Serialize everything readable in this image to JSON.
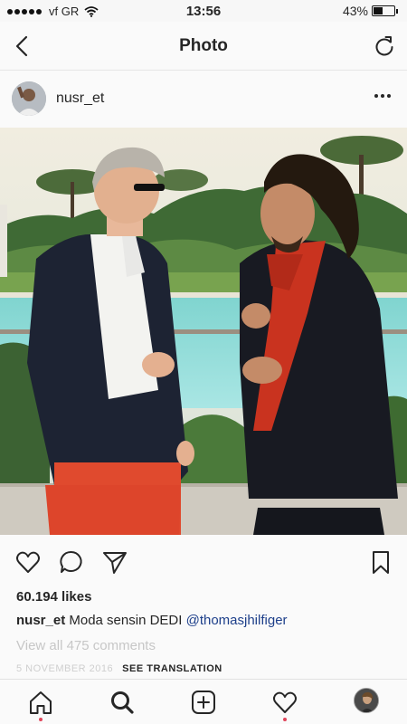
{
  "status_bar": {
    "carrier": "vf GR",
    "time": "13:56",
    "battery_percent_label": "43%",
    "battery_level": 0.43
  },
  "nav": {
    "title": "Photo",
    "back_icon": "chevron-left-icon",
    "refresh_icon": "refresh-icon"
  },
  "post": {
    "username": "nusr_et",
    "more_icon": "more-horizontal-icon",
    "likes": "60.194 likes",
    "caption_user": "nusr_et",
    "caption_text": "Moda sensin DEDI",
    "caption_mention": "@thomasjhilfiger",
    "comments_link": "View all 475 comments",
    "date": "5 NOVEMBER 2016",
    "translate": "SEE TRANSLATION"
  },
  "actions": [
    "heart-icon",
    "comment-icon",
    "share-icon",
    "bookmark-icon"
  ],
  "tab_bar": [
    "home-icon",
    "search-icon",
    "add-post-icon",
    "activity-heart-icon",
    "profile-avatar"
  ],
  "colors": {
    "mention": "#1d3f8a",
    "notification_dot": "#e0455a",
    "muted_text": "#c7c7c7"
  }
}
